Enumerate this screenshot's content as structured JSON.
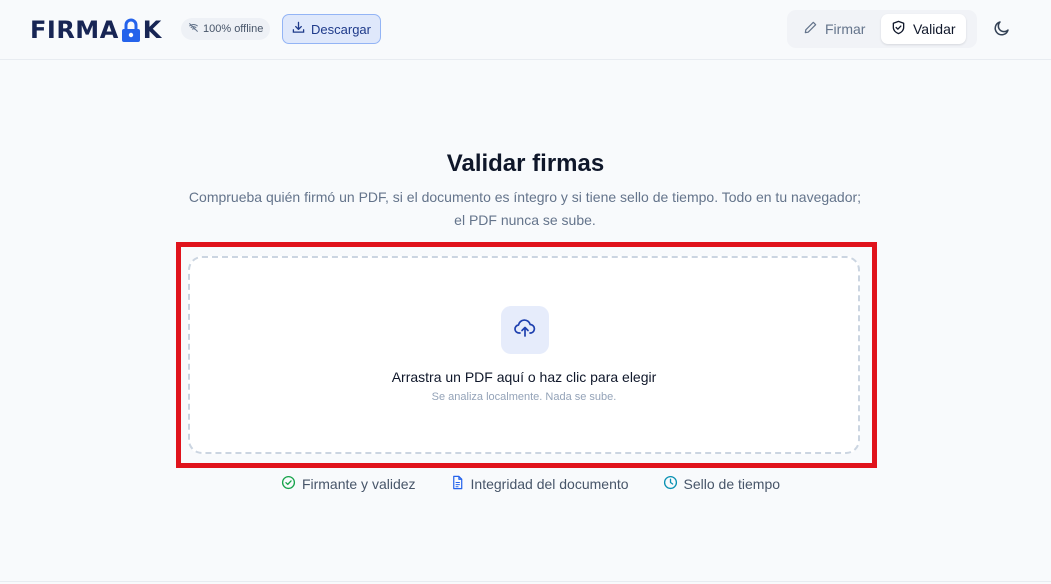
{
  "header": {
    "logo_text_left": "FIRMA",
    "logo_text_right": "K",
    "offline_badge": "100% offline",
    "download_label": "Descargar",
    "nav": [
      {
        "label": "Firmar",
        "icon": "pencil-icon",
        "active": false
      },
      {
        "label": "Validar",
        "icon": "shield-check-icon",
        "active": true
      }
    ],
    "theme_icon": "moon-icon"
  },
  "main": {
    "title": "Validar firmas",
    "subtitle_line1": "Comprueba quién firmó un PDF, si el documento es íntegro y si tiene sello de tiempo. Todo en tu navegador;",
    "subtitle_line2": "el PDF nunca se sube.",
    "dropzone": {
      "icon": "cloud-upload-icon",
      "main_text": "Arrastra un PDF aquí o haz clic para elegir",
      "sub_text": "Se analiza localmente. Nada se sube."
    },
    "features": [
      {
        "label": "Firmante y validez",
        "icon": "check-circle-icon",
        "color": "#16a34a"
      },
      {
        "label": "Integridad del documento",
        "icon": "document-icon",
        "color": "#2563eb"
      },
      {
        "label": "Sello de tiempo",
        "icon": "clock-icon",
        "color": "#0891b2"
      }
    ]
  },
  "colors": {
    "accent": "#2563eb",
    "highlight": "#e0131c",
    "background": "#f8fafc"
  }
}
